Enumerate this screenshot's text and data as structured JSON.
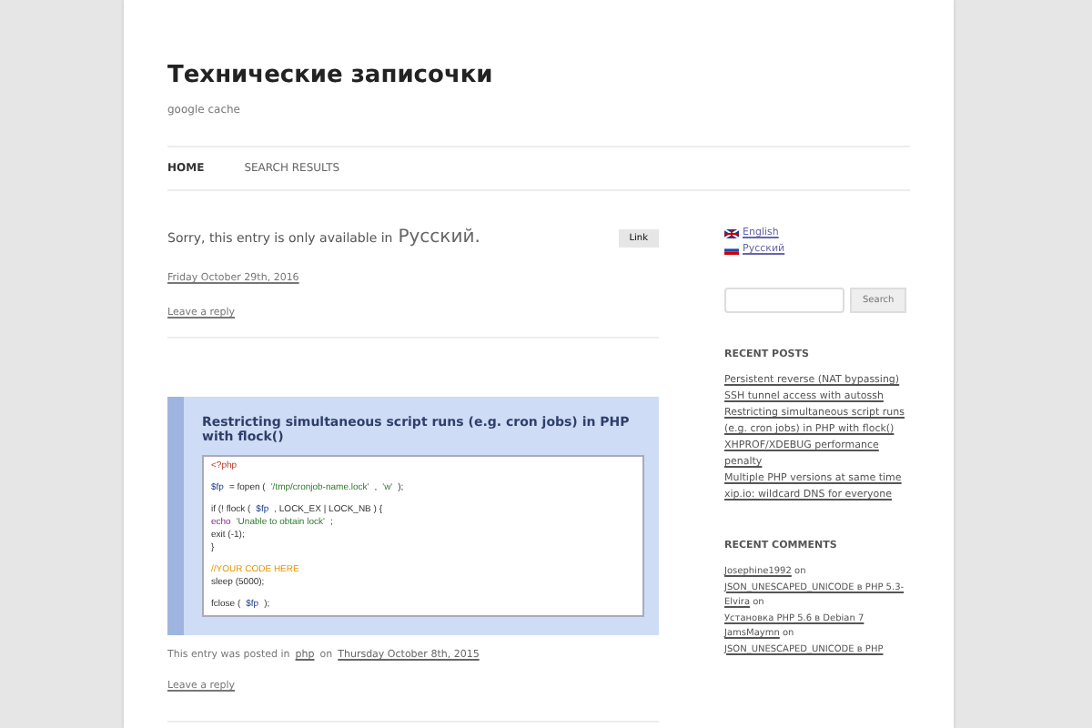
{
  "site": {
    "title": "Технические записочки",
    "tagline": "google cache"
  },
  "nav": [
    {
      "label": "HOME",
      "selected": true
    },
    {
      "label": "SEARCH RESULTS",
      "selected": false
    }
  ],
  "notice": {
    "text": "Sorry, this entry is only available in",
    "lang": "Русский.",
    "button": "Link"
  },
  "post_date": "Friday October 29th, 2016",
  "leave_reply": "Leave a reply",
  "snippet": {
    "title": "Restricting simultaneous script runs (e.g. cron jobs) in PHP with flock()",
    "lines": [
      {
        "spaced": false,
        "tokens": [
          {
            "kind": "tag",
            "text": "<?php"
          }
        ]
      },
      {
        "spaced": true,
        "tokens": [
          {
            "kind": "var",
            "text": "$fp"
          },
          {
            "kind": "plain",
            "text": "= fopen ("
          },
          {
            "kind": "string",
            "text": "'/tmp/cronjob-name.lock'"
          },
          {
            "kind": "plain",
            "text": ","
          },
          {
            "kind": "string",
            "text": "'w'"
          },
          {
            "kind": "plain",
            "text": ");"
          }
        ]
      },
      {
        "spaced": true,
        "tokens": [
          {
            "kind": "plain",
            "text": "if (! flock ("
          },
          {
            "kind": "var",
            "text": "$fp"
          },
          {
            "kind": "plain",
            "text": ", LOCK_EX | LOCK_NB ) {"
          }
        ]
      },
      {
        "spaced": false,
        "tokens": [
          {
            "kind": "keyword",
            "text": "echo"
          },
          {
            "kind": "string",
            "text": "'Unable to obtain lock'"
          },
          {
            "kind": "plain",
            "text": ";"
          }
        ]
      },
      {
        "spaced": false,
        "tokens": [
          {
            "kind": "plain",
            "text": "exit (-1);"
          }
        ]
      },
      {
        "spaced": false,
        "tokens": [
          {
            "kind": "plain",
            "text": "}"
          }
        ]
      },
      {
        "spaced": true,
        "tokens": [
          {
            "kind": "comment",
            "text": "//YOUR CODE HERE"
          }
        ]
      },
      {
        "spaced": false,
        "tokens": [
          {
            "kind": "plain",
            "text": "sleep (5000);"
          }
        ]
      },
      {
        "spaced": true,
        "tokens": [
          {
            "kind": "plain",
            "text": "fclose ("
          },
          {
            "kind": "var",
            "text": "$fp"
          },
          {
            "kind": "plain",
            "text": ");"
          }
        ]
      }
    ]
  },
  "post_meta": {
    "prefix": "This entry was posted in",
    "category": "php",
    "on": "on",
    "date": "Thursday October 8th, 2015"
  },
  "leave_reply_2": "Leave a reply",
  "languages": [
    {
      "label": "English",
      "kind": "uk"
    },
    {
      "label": "Русский",
      "kind": "ru"
    }
  ],
  "search": {
    "button": "Search"
  },
  "recent_posts": {
    "title": "RECENT POSTS",
    "items": [
      "Persistent reverse (NAT bypassing)",
      "SSH tunnel access with autossh",
      "Restricting simultaneous script runs (e.g. cron jobs) in PHP with flock()",
      "XHPROF/XDEBUG performance penalty",
      "Multiple PHP versions at same time",
      "xip.io: wildcard DNS for everyone"
    ]
  },
  "recent_comments": {
    "title": "RECENT COMMENTS",
    "items": [
      {
        "author": "Josephine1992",
        "on": "on",
        "post": "JSON_UNESCAPED_UNICODE в PHP 5.3-"
      },
      {
        "author": "Elvira",
        "on": "on",
        "post": "Установка PHP 5.6 в Debian 7"
      },
      {
        "author": "JamsMaymn",
        "on": "on",
        "post": "JSON_UNESCAPED_UNICODE в PHP"
      }
    ]
  }
}
